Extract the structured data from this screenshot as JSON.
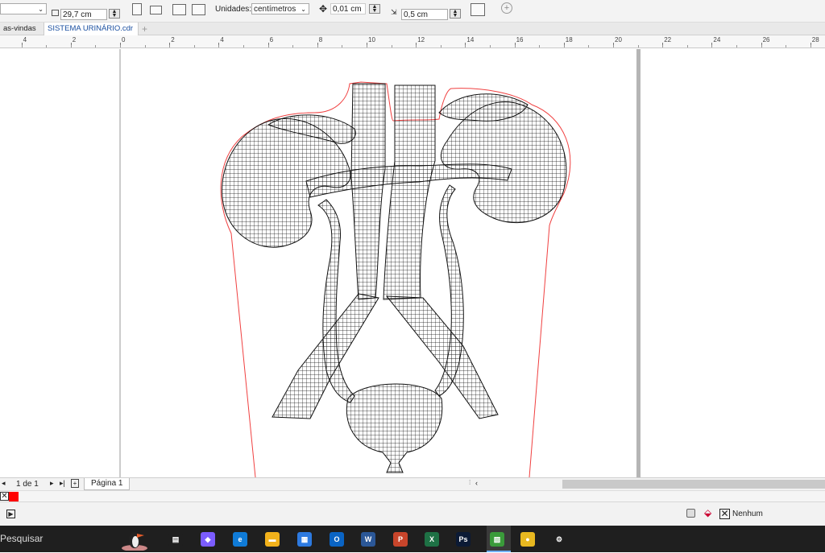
{
  "property_bar": {
    "height_value": "29,7 cm",
    "units_label": "Unidades:",
    "units_value": "centímetros",
    "nudge_value": "0,01 cm",
    "dup_distance_value": "0,5 cm"
  },
  "tabs": [
    {
      "label": "as-vindas"
    },
    {
      "label": "SISTEMA URINÁRIO.cdr"
    }
  ],
  "ruler_labels": [
    "4",
    "2",
    "0",
    "2",
    "4",
    "6",
    "8",
    "10",
    "12",
    "14",
    "16",
    "18",
    "20",
    "22",
    "24",
    "26",
    "28"
  ],
  "page_nav": {
    "counter": "1 de 1",
    "page_tab": "Página 1"
  },
  "status": {
    "outline_label": "Nenhum"
  },
  "taskbar": {
    "search_placeholder": "Pesquisar",
    "apps": [
      {
        "name": "task-view",
        "color": "#1f1f1f",
        "glyph": "▤"
      },
      {
        "name": "copilot",
        "color": "#7b5cff",
        "glyph": "◆"
      },
      {
        "name": "edge",
        "color": "#0f7bd7",
        "glyph": "e"
      },
      {
        "name": "file-explorer",
        "color": "#f2b21b",
        "glyph": "▬"
      },
      {
        "name": "store",
        "color": "#2d7ae0",
        "glyph": "▦"
      },
      {
        "name": "outlook",
        "color": "#0a64c4",
        "glyph": "O"
      },
      {
        "name": "word",
        "color": "#2b5797",
        "glyph": "W"
      },
      {
        "name": "powerpoint",
        "color": "#c8452b",
        "glyph": "P"
      },
      {
        "name": "excel",
        "color": "#1e7145",
        "glyph": "X"
      },
      {
        "name": "photoshop",
        "color": "#0b1a35",
        "glyph": "Ps"
      },
      {
        "name": "coreldraw",
        "color": "#3a9b3a",
        "glyph": "▧"
      },
      {
        "name": "chrome",
        "color": "#e8b820",
        "glyph": "●"
      },
      {
        "name": "settings",
        "color": "#1f1f1f",
        "glyph": "⚙"
      }
    ]
  }
}
